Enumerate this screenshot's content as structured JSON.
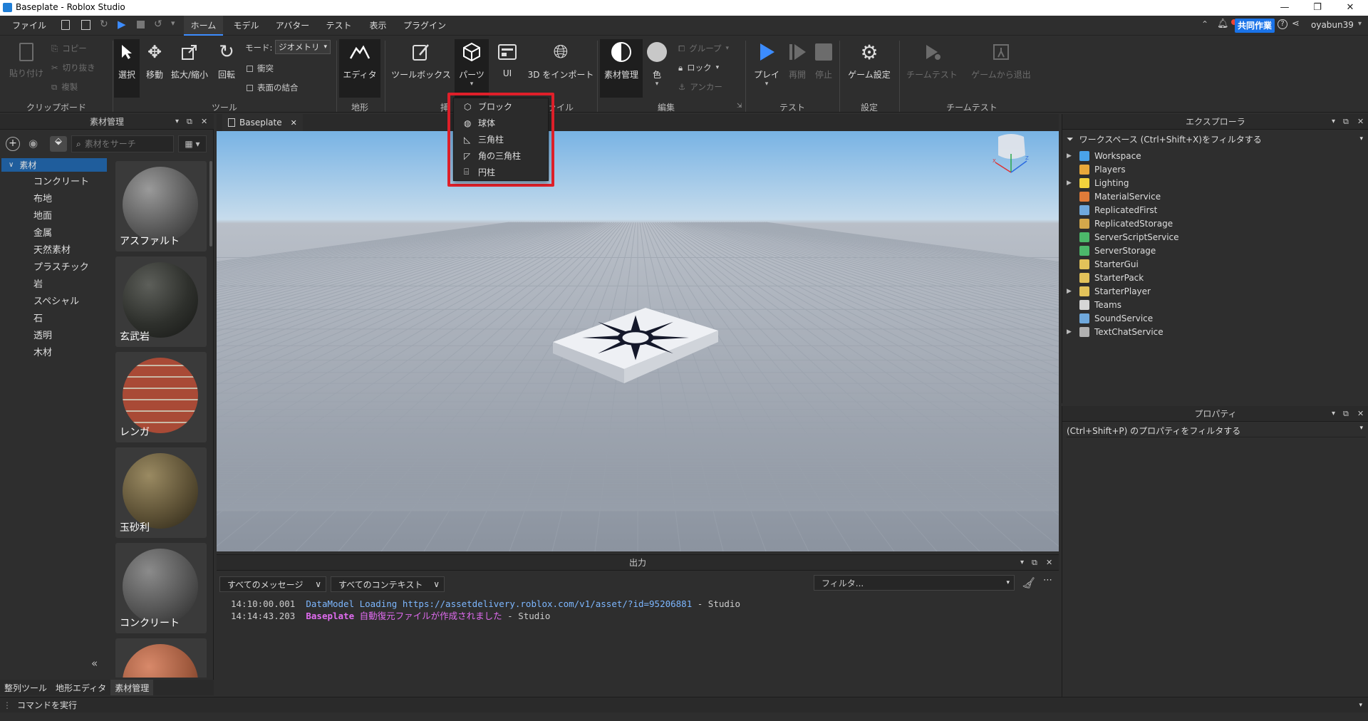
{
  "window": {
    "title": "Baseplate - Roblox Studio"
  },
  "menu": {
    "items": [
      "ファイル",
      "ホーム",
      "モデル",
      "アバター",
      "テスト",
      "表示",
      "プラグイン"
    ],
    "collab": "共同作業",
    "user": "oyabun39"
  },
  "ribbon": {
    "paste": "貼り付け",
    "copy": "コピー",
    "cut": "切り抜き",
    "duplicate": "複製",
    "select": "選択",
    "move": "移動",
    "scale": "拡大/縮小",
    "rotate": "回転",
    "mode_label": "モード:",
    "mode_value": "ジオメトリ",
    "collision": "衝突",
    "join": "表面の結合",
    "editor": "エディタ",
    "toolbox": "ツールボックス",
    "part": "パーツ",
    "ui": "UI",
    "import3d": "3D をインポート",
    "material": "素材管理",
    "color": "色",
    "group": "グループ",
    "lock": "ロック",
    "anchor": "アンカー",
    "play": "プレイ",
    "resume": "再開",
    "stop": "停止",
    "game_settings": "ゲーム設定",
    "team_test": "チームテスト",
    "exit_game": "ゲームから退出",
    "groups": {
      "clipboard": "クリップボード",
      "tools": "ツール",
      "terrain": "地形",
      "insert_partial": "挿",
      "file_partial": "ァイル",
      "edit": "編集",
      "test": "テスト",
      "settings": "設定",
      "team_test": "チームテスト"
    }
  },
  "part_menu": {
    "items": [
      "ブロック",
      "球体",
      "三角柱",
      "角の三角柱",
      "円柱"
    ]
  },
  "material_manager": {
    "title": "素材管理",
    "search_placeholder": "素材をサーチ",
    "root": "素材",
    "categories": [
      "コンクリート",
      "布地",
      "地面",
      "金属",
      "天然素材",
      "プラスチック",
      "岩",
      "スペシャル",
      "石",
      "透明",
      "木材"
    ],
    "materials": [
      "アスファルト",
      "玄武岩",
      "レンガ",
      "玉砂利",
      "コンクリート"
    ],
    "collapse": "«"
  },
  "bottom_tabs": [
    "整列ツール",
    "地形エディタ",
    "素材管理"
  ],
  "viewport": {
    "tab": "Baseplate"
  },
  "explorer": {
    "title": "エクスプローラ",
    "filter": "ワークスペース (Ctrl+Shift+X)をフィルタする",
    "items": [
      {
        "name": "Workspace",
        "color": "#4aa3e8",
        "expand": true
      },
      {
        "name": "Players",
        "color": "#e8a83a",
        "expand": false
      },
      {
        "name": "Lighting",
        "color": "#f2d23c",
        "expand": true
      },
      {
        "name": "MaterialService",
        "color": "#e07b39",
        "expand": false
      },
      {
        "name": "ReplicatedFirst",
        "color": "#6fa8dc",
        "expand": false
      },
      {
        "name": "ReplicatedStorage",
        "color": "#d4a84b",
        "expand": false
      },
      {
        "name": "ServerScriptService",
        "color": "#4cb86a",
        "expand": false
      },
      {
        "name": "ServerStorage",
        "color": "#4cb86a",
        "expand": false
      },
      {
        "name": "StarterGui",
        "color": "#e2c25a",
        "expand": false
      },
      {
        "name": "StarterPack",
        "color": "#e2c25a",
        "expand": false
      },
      {
        "name": "StarterPlayer",
        "color": "#e2c25a",
        "expand": true
      },
      {
        "name": "Teams",
        "color": "#d6d6d6",
        "expand": false
      },
      {
        "name": "SoundService",
        "color": "#6fa8dc",
        "expand": false
      },
      {
        "name": "TextChatService",
        "color": "#b0b0b0",
        "expand": true
      }
    ]
  },
  "properties": {
    "title": "プロパティ",
    "filter": "(Ctrl+Shift+P) のプロパティをフィルタする"
  },
  "output": {
    "title": "出力",
    "messages_filter": "すべてのメッセージ",
    "context_filter": "すべてのコンテキスト",
    "filter_placeholder": "フィルタ...",
    "lines": [
      {
        "time": "14:10:00.001",
        "msg": "DataModel Loading https://assetdelivery.roblox.com/v1/asset/?id=95206881",
        "src": "  -  Studio"
      },
      {
        "time": "14:14:43.203",
        "bold": "Baseplate",
        "msg": " 自動復元ファイルが作成されました",
        "src": "  -  Studio"
      }
    ]
  },
  "command_bar": {
    "placeholder": "コマンドを実行"
  },
  "colors": {
    "accent": "#3c8cff",
    "highlight": "#e0202a",
    "sky_top": "#7fb7e6",
    "floor": "#8a93a0"
  }
}
